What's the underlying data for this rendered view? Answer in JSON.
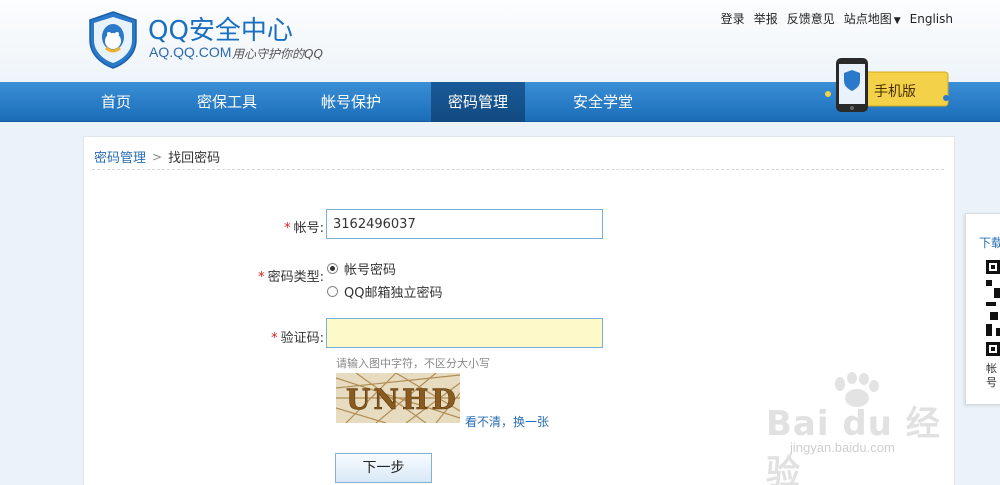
{
  "header": {
    "logo_title": "QQ安全中心",
    "logo_domain": "AQ.QQ.COM",
    "logo_slogan": "用心守护你的QQ",
    "toplinks": {
      "login": "登录",
      "report": "举报",
      "feedback": "反馈意见",
      "sitemap": "站点地图",
      "english": "English"
    }
  },
  "nav": {
    "items": [
      {
        "label": "首页"
      },
      {
        "label": "密保工具"
      },
      {
        "label": "帐号保护"
      },
      {
        "label": "密码管理"
      },
      {
        "label": "安全学堂"
      }
    ],
    "mobile_label": "手机版"
  },
  "breadcrumb": {
    "parent": "密码管理",
    "separator": ">",
    "current": "找回密码"
  },
  "form": {
    "required_mark": "*",
    "account_label": "帐号:",
    "account_value": "3162496037",
    "pwd_type_label": "密码类型:",
    "pwd_options": [
      "帐号密码",
      "QQ邮箱独立密码"
    ],
    "pwd_selected": 0,
    "captcha_label": "验证码:",
    "captcha_value": "",
    "captcha_hint": "请输入图中字符，不区分大小写",
    "captcha_image_text": "UNHD",
    "refresh_text": "看不清，换一张",
    "next_button": "下一步"
  },
  "side_panel": {
    "title": "下载",
    "footer": "帐号"
  },
  "watermark": {
    "main": "Bai du 经验",
    "sub": "jingyan.baidu.com"
  },
  "colors": {
    "nav_blue": "#2a7fcb",
    "nav_active": "#164f86",
    "link_blue": "#2a6db1",
    "required_red": "#e0191d",
    "captcha_input_bg": "#fdf9c9"
  }
}
